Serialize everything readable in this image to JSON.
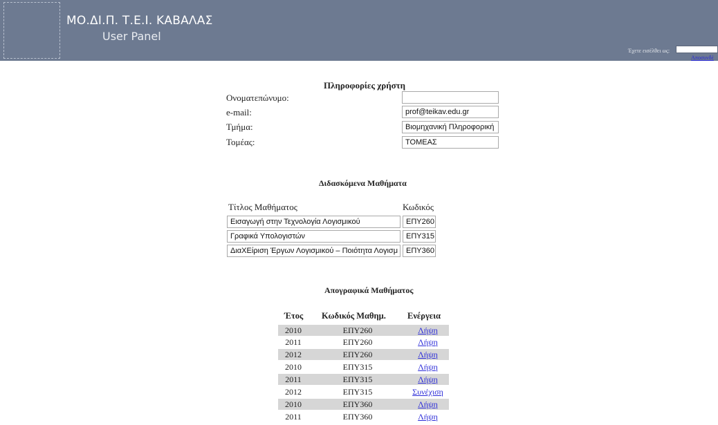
{
  "header": {
    "site_title": "ΜΟ.ΔΙ.Π. Τ.Ε.Ι. ΚΑΒΑΛΑΣ",
    "site_subtitle": "User Panel",
    "login_label": "Έχετε εισέλθει ως:",
    "login_value": "",
    "logout_label": "Αποσυνδέ"
  },
  "user_info": {
    "title": "Πληροφορίες χρήστη",
    "fields": [
      {
        "label": "Ονοματεπώνυμο:",
        "value": ""
      },
      {
        "label": "e-mail:",
        "value": "prof@teikav.edu.gr"
      },
      {
        "label": "Τμήμα:",
        "value": "Βιομηχανική Πληροφορική"
      },
      {
        "label": "Τομέας:",
        "value": "ΤΟΜΕΑΣ"
      }
    ]
  },
  "courses": {
    "title": "Διδασκόμενα Μαθήματα",
    "col_title": "Τίτλος Μαθήματος",
    "col_code": "Κωδικός",
    "rows": [
      {
        "title": "Εισαγωγή στην Τεχνολογία Λογισμικού",
        "code": "ΕΠΥ260"
      },
      {
        "title": "Γραφικά Υπολογιστών",
        "code": "ΕΠΥ315"
      },
      {
        "title": "ΔιαΧΕίριση Έργων Λογισμικού – Ποιότητα Λογισμ",
        "code": "ΕΠΥ360"
      }
    ]
  },
  "records": {
    "title": "Απογραφικά Μαθήματος",
    "col_year": "Έτος",
    "col_code": "Κωδικός Μαθημ.",
    "col_action": "Ενέργεια",
    "rows": [
      {
        "year": "2010",
        "code": "ΕΠΥ260",
        "action": "Λήψη"
      },
      {
        "year": "2011",
        "code": "ΕΠΥ260",
        "action": "Λήψη"
      },
      {
        "year": "2012",
        "code": "ΕΠΥ260",
        "action": "Λήψη"
      },
      {
        "year": "2010",
        "code": "ΕΠΥ315",
        "action": "Λήψη"
      },
      {
        "year": "2011",
        "code": "ΕΠΥ315",
        "action": "Λήψη"
      },
      {
        "year": "2012",
        "code": "ΕΠΥ315",
        "action": "Συνέχιση"
      },
      {
        "year": "2010",
        "code": "ΕΠΥ360",
        "action": "Λήψη"
      },
      {
        "year": "2011",
        "code": "ΕΠΥ360",
        "action": "Λήψη"
      }
    ]
  }
}
